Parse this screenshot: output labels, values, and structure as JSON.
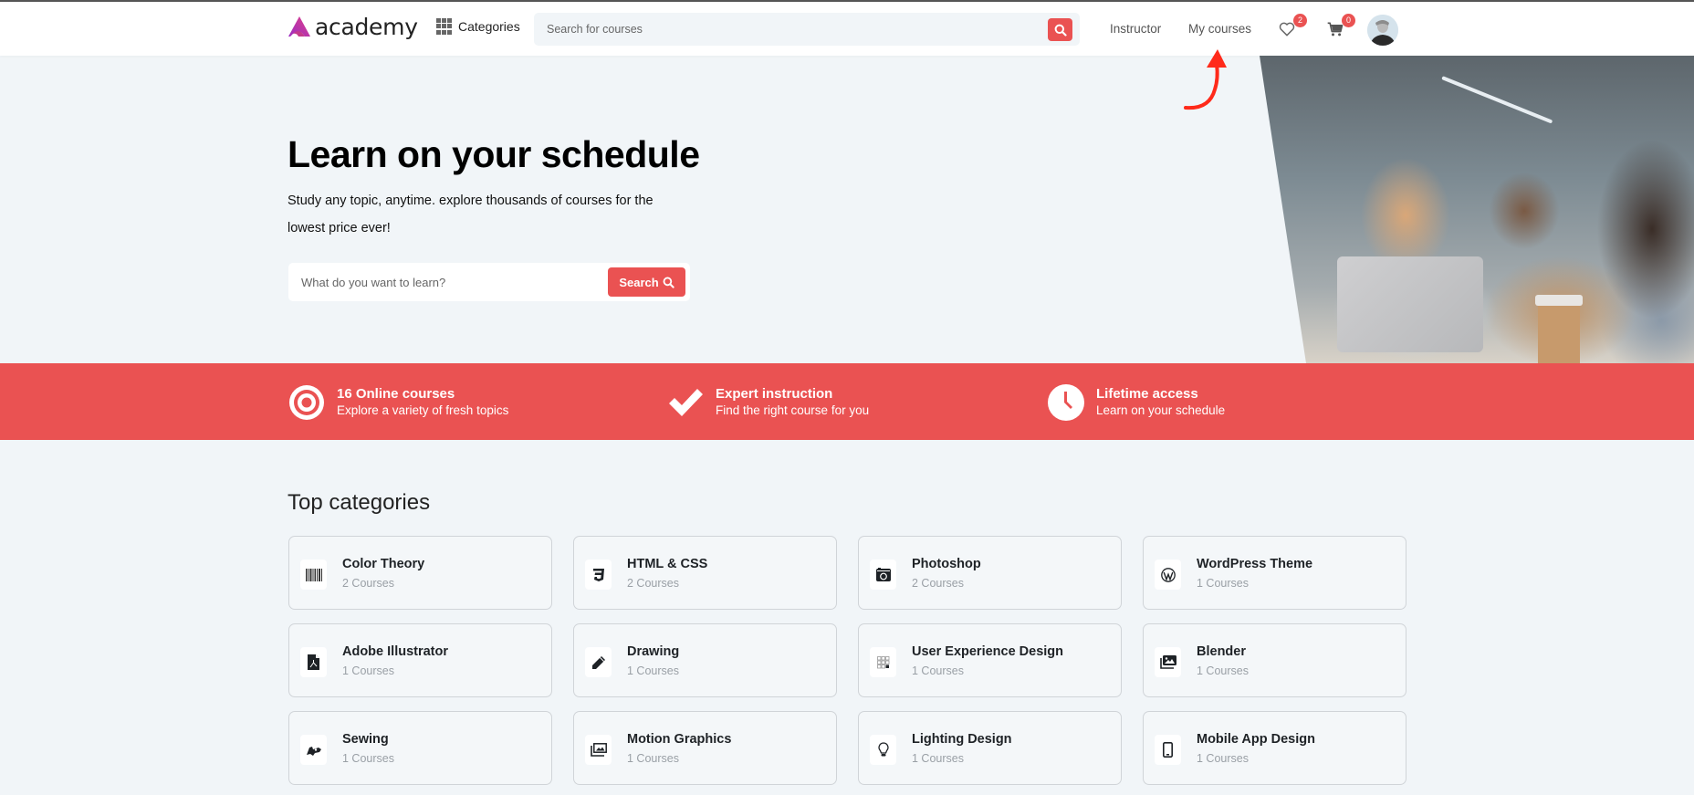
{
  "header": {
    "logo_text": "academy",
    "categories_label": "Categories",
    "search_placeholder": "Search for courses",
    "nav": [
      {
        "label": "Instructor"
      },
      {
        "label": "My courses"
      }
    ],
    "wishlist_count": "2",
    "cart_count": "0",
    "icons": {
      "categories": "grid-icon",
      "search": "search-icon",
      "wishlist": "heart-icon",
      "cart": "cart-icon",
      "avatar": "user-avatar"
    }
  },
  "annotation": {
    "type": "red-curved-arrow",
    "points_to": "My courses",
    "color": "#ff2a1a"
  },
  "hero": {
    "title": "Learn on your schedule",
    "subtitle": "Study any topic, anytime. explore thousands of courses for the lowest price ever!",
    "search_placeholder": "What do you want to learn?",
    "search_button": "Search",
    "image_alt": "Three students looking at a laptop"
  },
  "features": [
    {
      "icon": "target-icon",
      "title": "16 Online courses",
      "description": "Explore a variety of fresh topics"
    },
    {
      "icon": "check-icon",
      "title": "Expert instruction",
      "description": "Find the right course for you"
    },
    {
      "icon": "clock-icon",
      "title": "Lifetime access",
      "description": "Learn on your schedule"
    }
  ],
  "top_categories": {
    "title": "Top categories",
    "items": [
      {
        "name": "Color Theory",
        "count": "2 Courses",
        "icon": "barcode-icon"
      },
      {
        "name": "HTML & CSS",
        "count": "2 Courses",
        "icon": "css3-icon"
      },
      {
        "name": "Photoshop",
        "count": "2 Courses",
        "icon": "camera-icon"
      },
      {
        "name": "WordPress Theme",
        "count": "1 Courses",
        "icon": "wordpress-icon"
      },
      {
        "name": "Adobe Illustrator",
        "count": "1 Courses",
        "icon": "file-pdf-icon"
      },
      {
        "name": "Drawing",
        "count": "1 Courses",
        "icon": "pencil-icon"
      },
      {
        "name": "User Experience Design",
        "count": "1 Courses",
        "icon": "grid-squares-icon"
      },
      {
        "name": "Blender",
        "count": "1 Courses",
        "icon": "images-icon"
      },
      {
        "name": "Sewing",
        "count": "1 Courses",
        "icon": "sewing-icon"
      },
      {
        "name": "Motion Graphics",
        "count": "1 Courses",
        "icon": "photo-stack-icon"
      },
      {
        "name": "Lighting Design",
        "count": "1 Courses",
        "icon": "lightbulb-icon"
      },
      {
        "name": "Mobile App Design",
        "count": "1 Courses",
        "icon": "mobile-icon"
      }
    ]
  },
  "colors": {
    "accent": "#ea5252",
    "page_bg": "#f1f5f8",
    "logo_gradient": [
      "#e0408a",
      "#8a2be2"
    ]
  }
}
